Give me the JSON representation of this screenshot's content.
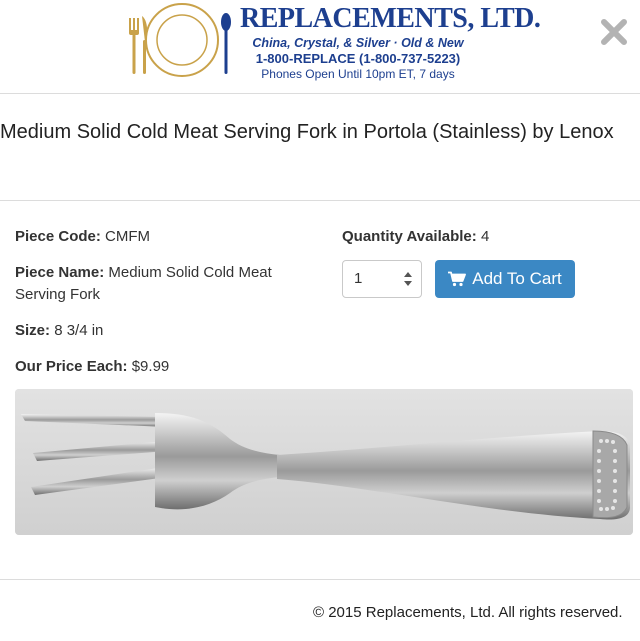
{
  "header": {
    "brand_name": "REPLACEMENTS, LTD.",
    "tagline": "China, Crystal, & Silver · Old & New",
    "phone": "1-800-REPLACE (1-800-737-5223)",
    "hours": "Phones Open Until 10pm ET, 7 days"
  },
  "product": {
    "title": "Medium Solid Cold Meat Serving Fork in Portola (Stainless) by Lenox",
    "piece_code_label": "Piece Code:",
    "piece_code": "CMFM",
    "piece_name_label": "Piece Name:",
    "piece_name": "Medium Solid Cold Meat Serving Fork",
    "size_label": "Size:",
    "size": "8 3/4 in",
    "price_label": "Our Price Each:",
    "price": "$9.99",
    "qty_available_label": "Quantity Available:",
    "qty_available": "4",
    "qty_selected": "1",
    "add_to_cart": "Add To Cart"
  },
  "footer": {
    "copyright": "© 2015 Replacements, Ltd. All rights reserved."
  },
  "colors": {
    "brand_blue": "#1d3f8f",
    "brand_gold": "#c9a24a",
    "button_blue": "#3b88c4"
  },
  "icons": {
    "close": "close-icon",
    "cart": "cart-icon",
    "select_arrows": "select-arrows-icon"
  }
}
